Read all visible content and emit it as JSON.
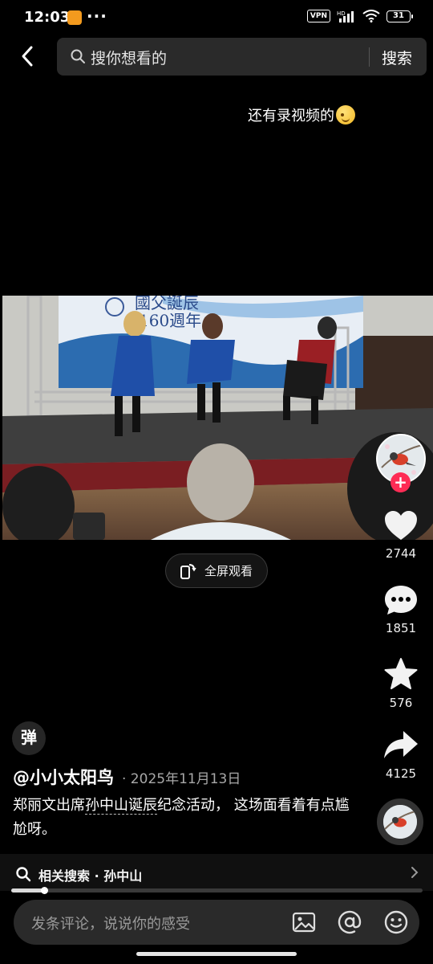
{
  "status_bar": {
    "time": "12:03",
    "dots": "···",
    "vpn": "VPN",
    "battery": "31"
  },
  "header": {
    "search_placeholder": "搜你想看的",
    "search_button": "搜索"
  },
  "overlay_caption": "还有录视频的",
  "video": {
    "banner_text_line1": "國父誕辰",
    "banner_text_line2": "160週年",
    "fullscreen_label": "全屏观看"
  },
  "actions": {
    "likes": "2744",
    "comments": "1851",
    "favorites": "576",
    "shares": "4125"
  },
  "danmaku_label": "弹",
  "post": {
    "author": "@小小太阳鸟",
    "date": "· 2025年11月13日",
    "desc_prefix": "郑丽文出席",
    "desc_link": "孙中山诞辰",
    "desc_suffix": "纪念活动，  这场面看着有点尴尬呀。"
  },
  "related": {
    "label": "相关搜索 · 孙中山"
  },
  "progress": 0.08,
  "comment": {
    "placeholder": "发条评论，说说你的感受"
  },
  "colors": {
    "accent": "#fe2c55",
    "background": "#000000"
  }
}
